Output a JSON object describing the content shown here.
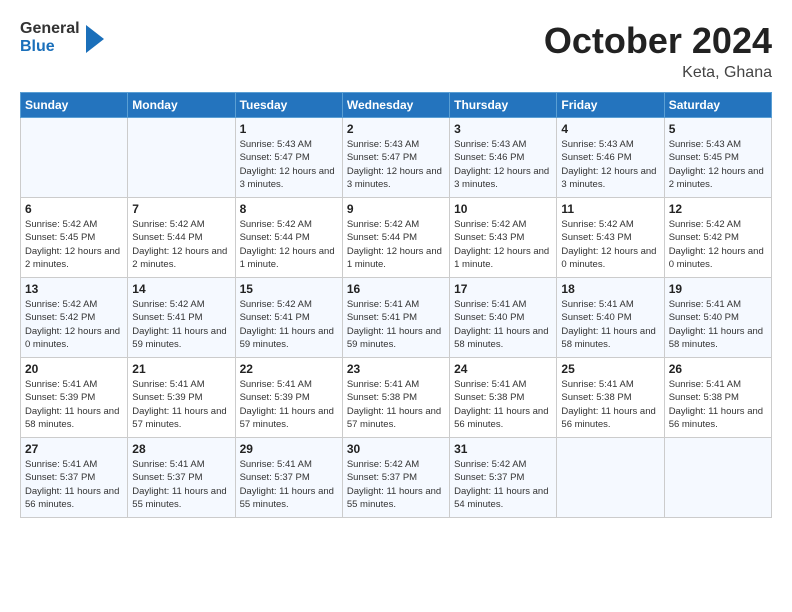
{
  "header": {
    "logo_general": "General",
    "logo_blue": "Blue",
    "month_title": "October 2024",
    "location": "Keta, Ghana"
  },
  "days_of_week": [
    "Sunday",
    "Monday",
    "Tuesday",
    "Wednesday",
    "Thursday",
    "Friday",
    "Saturday"
  ],
  "weeks": [
    [
      {
        "day": "",
        "detail": ""
      },
      {
        "day": "",
        "detail": ""
      },
      {
        "day": "1",
        "detail": "Sunrise: 5:43 AM\nSunset: 5:47 PM\nDaylight: 12 hours and 3 minutes."
      },
      {
        "day": "2",
        "detail": "Sunrise: 5:43 AM\nSunset: 5:47 PM\nDaylight: 12 hours and 3 minutes."
      },
      {
        "day": "3",
        "detail": "Sunrise: 5:43 AM\nSunset: 5:46 PM\nDaylight: 12 hours and 3 minutes."
      },
      {
        "day": "4",
        "detail": "Sunrise: 5:43 AM\nSunset: 5:46 PM\nDaylight: 12 hours and 3 minutes."
      },
      {
        "day": "5",
        "detail": "Sunrise: 5:43 AM\nSunset: 5:45 PM\nDaylight: 12 hours and 2 minutes."
      }
    ],
    [
      {
        "day": "6",
        "detail": "Sunrise: 5:42 AM\nSunset: 5:45 PM\nDaylight: 12 hours and 2 minutes."
      },
      {
        "day": "7",
        "detail": "Sunrise: 5:42 AM\nSunset: 5:44 PM\nDaylight: 12 hours and 2 minutes."
      },
      {
        "day": "8",
        "detail": "Sunrise: 5:42 AM\nSunset: 5:44 PM\nDaylight: 12 hours and 1 minute."
      },
      {
        "day": "9",
        "detail": "Sunrise: 5:42 AM\nSunset: 5:44 PM\nDaylight: 12 hours and 1 minute."
      },
      {
        "day": "10",
        "detail": "Sunrise: 5:42 AM\nSunset: 5:43 PM\nDaylight: 12 hours and 1 minute."
      },
      {
        "day": "11",
        "detail": "Sunrise: 5:42 AM\nSunset: 5:43 PM\nDaylight: 12 hours and 0 minutes."
      },
      {
        "day": "12",
        "detail": "Sunrise: 5:42 AM\nSunset: 5:42 PM\nDaylight: 12 hours and 0 minutes."
      }
    ],
    [
      {
        "day": "13",
        "detail": "Sunrise: 5:42 AM\nSunset: 5:42 PM\nDaylight: 12 hours and 0 minutes."
      },
      {
        "day": "14",
        "detail": "Sunrise: 5:42 AM\nSunset: 5:41 PM\nDaylight: 11 hours and 59 minutes."
      },
      {
        "day": "15",
        "detail": "Sunrise: 5:42 AM\nSunset: 5:41 PM\nDaylight: 11 hours and 59 minutes."
      },
      {
        "day": "16",
        "detail": "Sunrise: 5:41 AM\nSunset: 5:41 PM\nDaylight: 11 hours and 59 minutes."
      },
      {
        "day": "17",
        "detail": "Sunrise: 5:41 AM\nSunset: 5:40 PM\nDaylight: 11 hours and 58 minutes."
      },
      {
        "day": "18",
        "detail": "Sunrise: 5:41 AM\nSunset: 5:40 PM\nDaylight: 11 hours and 58 minutes."
      },
      {
        "day": "19",
        "detail": "Sunrise: 5:41 AM\nSunset: 5:40 PM\nDaylight: 11 hours and 58 minutes."
      }
    ],
    [
      {
        "day": "20",
        "detail": "Sunrise: 5:41 AM\nSunset: 5:39 PM\nDaylight: 11 hours and 58 minutes."
      },
      {
        "day": "21",
        "detail": "Sunrise: 5:41 AM\nSunset: 5:39 PM\nDaylight: 11 hours and 57 minutes."
      },
      {
        "day": "22",
        "detail": "Sunrise: 5:41 AM\nSunset: 5:39 PM\nDaylight: 11 hours and 57 minutes."
      },
      {
        "day": "23",
        "detail": "Sunrise: 5:41 AM\nSunset: 5:38 PM\nDaylight: 11 hours and 57 minutes."
      },
      {
        "day": "24",
        "detail": "Sunrise: 5:41 AM\nSunset: 5:38 PM\nDaylight: 11 hours and 56 minutes."
      },
      {
        "day": "25",
        "detail": "Sunrise: 5:41 AM\nSunset: 5:38 PM\nDaylight: 11 hours and 56 minutes."
      },
      {
        "day": "26",
        "detail": "Sunrise: 5:41 AM\nSunset: 5:38 PM\nDaylight: 11 hours and 56 minutes."
      }
    ],
    [
      {
        "day": "27",
        "detail": "Sunrise: 5:41 AM\nSunset: 5:37 PM\nDaylight: 11 hours and 56 minutes."
      },
      {
        "day": "28",
        "detail": "Sunrise: 5:41 AM\nSunset: 5:37 PM\nDaylight: 11 hours and 55 minutes."
      },
      {
        "day": "29",
        "detail": "Sunrise: 5:41 AM\nSunset: 5:37 PM\nDaylight: 11 hours and 55 minutes."
      },
      {
        "day": "30",
        "detail": "Sunrise: 5:42 AM\nSunset: 5:37 PM\nDaylight: 11 hours and 55 minutes."
      },
      {
        "day": "31",
        "detail": "Sunrise: 5:42 AM\nSunset: 5:37 PM\nDaylight: 11 hours and 54 minutes."
      },
      {
        "day": "",
        "detail": ""
      },
      {
        "day": "",
        "detail": ""
      }
    ]
  ]
}
